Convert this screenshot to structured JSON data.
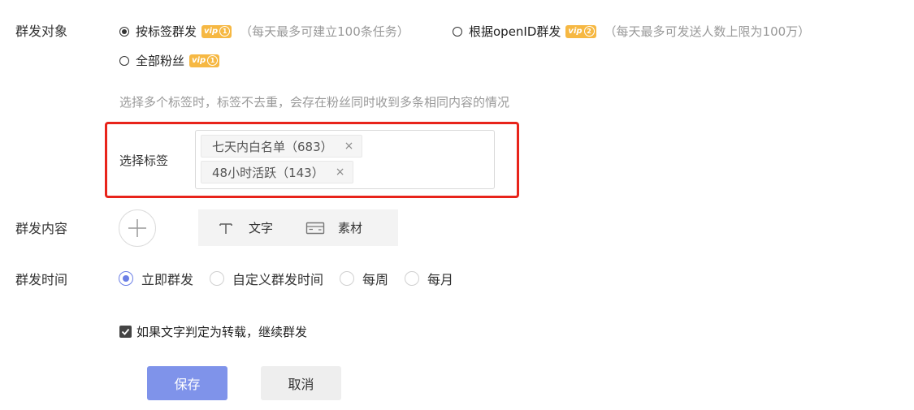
{
  "target": {
    "label": "群发对象",
    "options": [
      {
        "text": "按标签群发",
        "vip": "vip",
        "vip_level": "1",
        "hint": "（每天最多可建立100条任务）",
        "checked": true
      },
      {
        "text": "根据openID群发",
        "vip": "vip",
        "vip_level": "2",
        "hint": "（每天最多可发送人数上限为100万）",
        "checked": false
      },
      {
        "text": "全部粉丝",
        "vip": "vip",
        "vip_level": "1",
        "hint": "",
        "checked": false
      }
    ],
    "description": "选择多个标签时，标签不去重，会存在粉丝同时收到多条相同内容的情况"
  },
  "tag_select": {
    "label": "选择标签",
    "tags": [
      {
        "text": "七天内白名单（683）",
        "remove": "×"
      },
      {
        "text": "48小时活跃（143）",
        "remove": "×"
      }
    ]
  },
  "content": {
    "label": "群发内容",
    "add_icon": "plus-icon",
    "types": [
      {
        "icon": "text-t-icon",
        "text": "文字"
      },
      {
        "icon": "card-icon",
        "text": "素材"
      }
    ]
  },
  "time": {
    "label": "群发时间",
    "options": [
      {
        "text": "立即群发",
        "checked": true
      },
      {
        "text": "自定义群发时间",
        "checked": false
      },
      {
        "text": "每周",
        "checked": false
      },
      {
        "text": "每月",
        "checked": false
      }
    ]
  },
  "repost": {
    "text": "如果文字判定为转载，继续群发",
    "checked": true
  },
  "actions": {
    "save": "保存",
    "cancel": "取消"
  },
  "colors": {
    "primary": "#7f93ea",
    "highlight": "#e8241b",
    "vip": "#f6b843",
    "radio_active": "#6b7fe6"
  }
}
